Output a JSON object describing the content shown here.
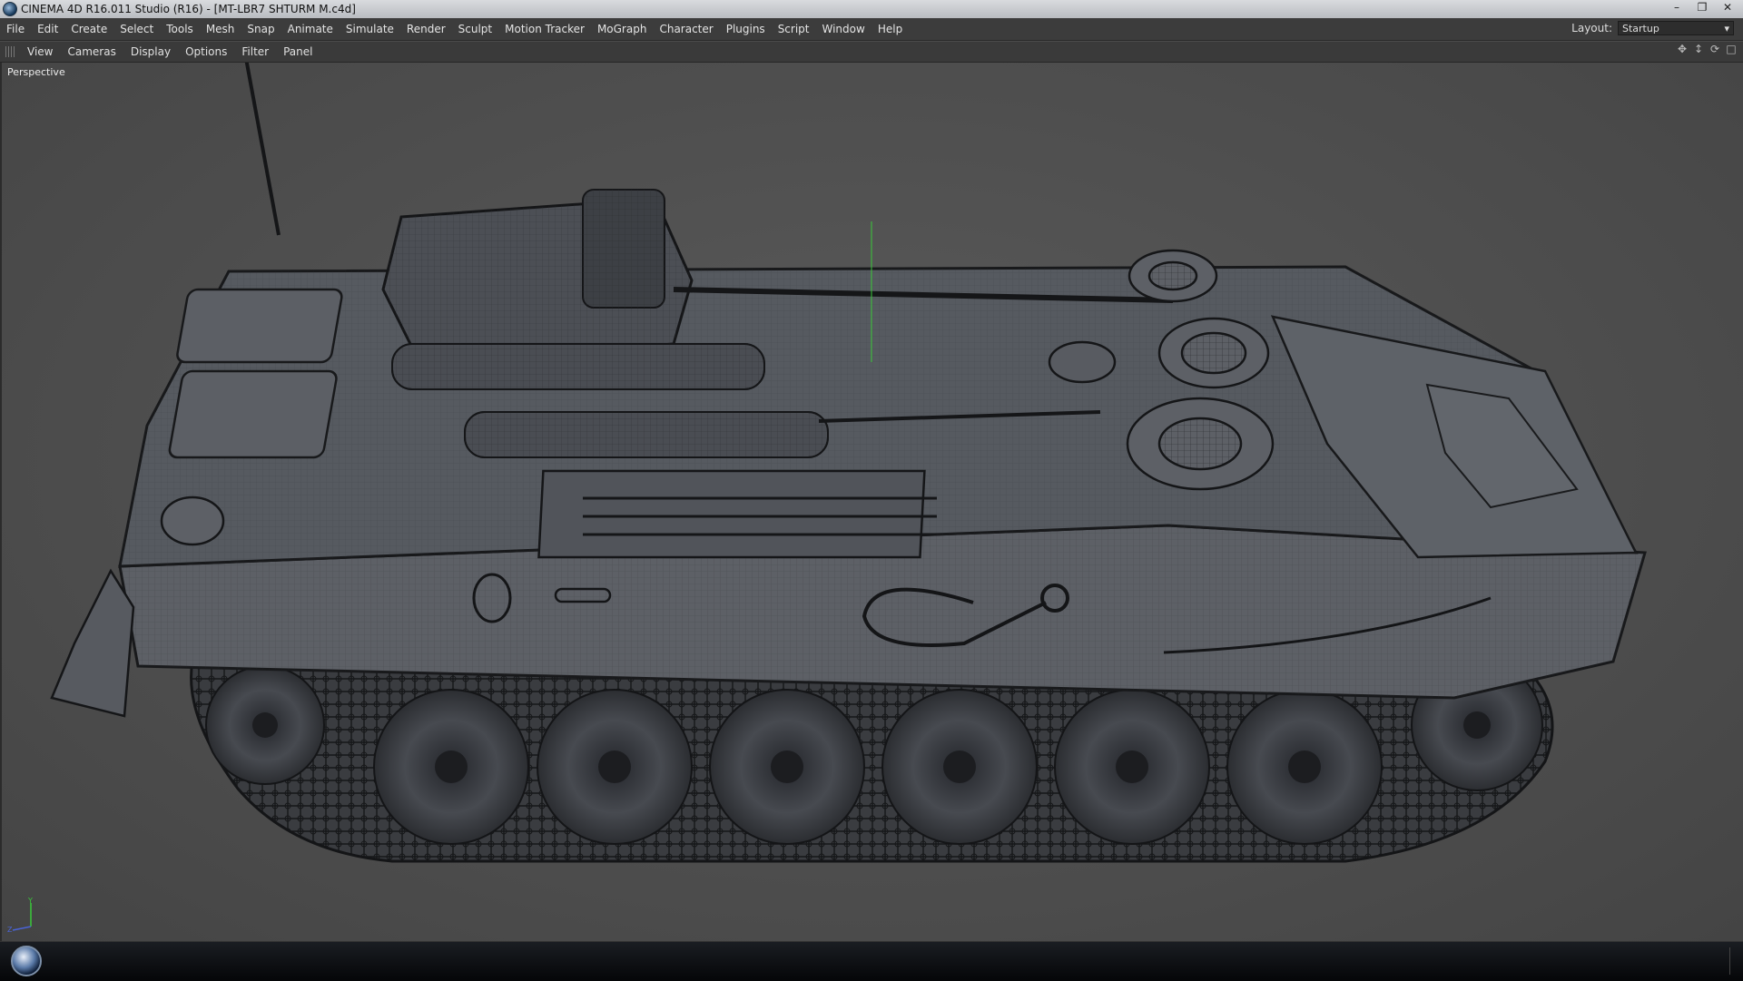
{
  "window": {
    "title": "CINEMA 4D R16.011 Studio (R16) - [MT-LBR7 SHTURM M.c4d]",
    "app_icon": "cinema4d-icon",
    "controls": [
      "minimize-icon",
      "restore-icon",
      "close-icon"
    ]
  },
  "menubar": {
    "items": [
      "File",
      "Edit",
      "Create",
      "Select",
      "Tools",
      "Mesh",
      "Snap",
      "Animate",
      "Simulate",
      "Render",
      "Sculpt",
      "Motion Tracker",
      "MoGraph",
      "Character",
      "Plugins",
      "Script",
      "Window",
      "Help"
    ],
    "layout_label": "Layout:",
    "layout_value": "Startup"
  },
  "viewport_menu": {
    "items": [
      "View",
      "Cameras",
      "Display",
      "Options",
      "Filter",
      "Panel"
    ],
    "nav_icons": [
      "move-view-icon",
      "zoom-view-icon",
      "rotate-view-icon",
      "toggle-view-icon"
    ]
  },
  "viewport": {
    "label": "Perspective",
    "axis_y": "Y",
    "axis_z": "Z",
    "model": "wireframe-tracked-vehicle",
    "colors": {
      "background": "#4b4b4b",
      "mesh_fill": "#5a5d63",
      "mesh_line": "#1b1c1f",
      "axis_y": "#39c939",
      "axis_z": "#4a63d6"
    }
  },
  "taskbar": {
    "start_icon": "windows-start-icon"
  }
}
